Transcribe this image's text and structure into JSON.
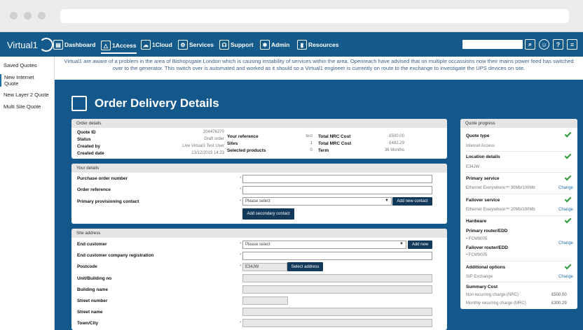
{
  "nav": {
    "logo": "Virtual1",
    "items": [
      "Dashboard",
      "1Access",
      "1Cloud",
      "Services",
      "Support",
      "Admin",
      "Resources"
    ]
  },
  "sidebar": [
    "Saved Quotes",
    "New Internet Quote",
    "New Layer 2 Quote",
    "Multi Site Quote"
  ],
  "banner": "Virtual1 are aware of a problem in the area of Bishopsgate London which is causing instability of services within the area. Openreach have advised that on multiple occassions now their mains power feed has switched over to the generator. This switch over is automated and worked as it should so a Virtual1 engineer is currently on route to the exchange to investigate the UPS devices on site.",
  "page_title": "Order Delivery Details",
  "order_details": {
    "header": "Order details",
    "quote_id_label": "Quote ID",
    "quote_id": "204476270",
    "status_label": "Status",
    "status": "Draft order",
    "created_by_label": "Created by",
    "created_by": "Live Virtual1 Test User",
    "created_date_label": "Created date",
    "created_date": "13/12/2019 14:23",
    "your_ref_label": "Your reference",
    "your_ref": "test",
    "sites_label": "Sites",
    "sites": "1",
    "selected_products_label": "Selected products",
    "selected_products": "0",
    "total_nrc_label": "Total NRC Cost",
    "total_nrc": "£500.00",
    "total_mrc_label": "Total MRC Cost",
    "total_mrc": "£482.29",
    "term_label": "Term",
    "term": "36 Months"
  },
  "your_details": {
    "header": "Your details",
    "po_label": "Purchase order number",
    "ref_label": "Order reference",
    "contact_label": "Primary provisioning contact",
    "contact_placeholder": "Please select",
    "add_contact": "Add new contact",
    "add_secondary": "Add secondary contact"
  },
  "site_address": {
    "header": "Site address",
    "end_customer_label": "End customer",
    "end_customer_placeholder": "Please select",
    "add_new": "Add new",
    "company_reg_label": "End customer company registration",
    "postcode_label": "Postcode",
    "postcode_value": "E34JW",
    "select_address": "Select address",
    "unit_label": "Unit/Building no",
    "building_label": "Building name",
    "street_no_label": "Street number",
    "street_name_label": "Street name",
    "town_label": "Town/City"
  },
  "quote_progress": {
    "header": "Quote progress",
    "quote_type_label": "Quote type",
    "quote_type": "Internet Access",
    "location_label": "Location details",
    "location": "E34JW",
    "primary_label": "Primary service",
    "primary": "Ethernet Everywhere™ 30Mb/100Mb",
    "failover_label": "Failover service",
    "failover": "Ethernet Everywhere™ 20Mb/100Mb",
    "hardware_label": "Hardware",
    "primary_router_label": "Primary router/EDD",
    "primary_router": "• FCM9005",
    "failover_router_label": "Failover router/EDD",
    "failover_router": "• FCM9005",
    "additional_label": "Additional options",
    "additional": "SIP Exchange",
    "summary_label": "Summary Cost",
    "nrc_label": "Non recurring charge (NRC)",
    "nrc": "£500.00",
    "mrc_label": "Monthly recurring charge (MRC)",
    "mrc": "£300.29",
    "change": "Change"
  }
}
